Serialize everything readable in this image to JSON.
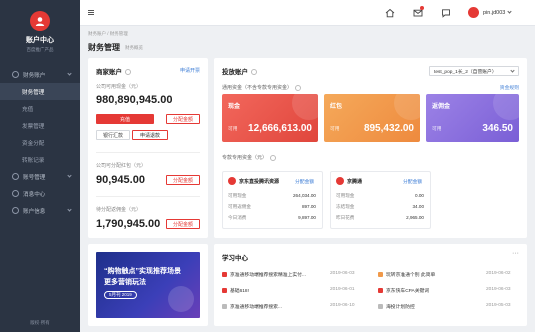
{
  "sidebar": {
    "title": "账户中心",
    "subtitle": "百度推广产品",
    "items": [
      {
        "label": "财务账户",
        "type": "group"
      },
      {
        "label": "财务管理",
        "type": "active"
      },
      {
        "label": "充值",
        "type": "sub"
      },
      {
        "label": "发票管理",
        "type": "sub"
      },
      {
        "label": "资金分配",
        "type": "sub"
      },
      {
        "label": "转账记录",
        "type": "sub"
      },
      {
        "label": "账号管理",
        "type": "group"
      },
      {
        "label": "消息中心",
        "type": "group"
      },
      {
        "label": "账户信息",
        "type": "group"
      }
    ],
    "footer": "版权·所有"
  },
  "topbar": {
    "username": "pin.jd003"
  },
  "breadcrumb": "财务账户  /  财务管理",
  "page": {
    "title": "财务管理",
    "subtitle": "财务概览"
  },
  "merchant": {
    "title": "商家账户",
    "open_link": "申请开票",
    "balance_label": "公司可用现金（元）",
    "balance": "980,890,945.00",
    "recharge_btn": "充值",
    "allocate_btn": "分配金额",
    "bank_transfer_btn": "银行汇款",
    "apply_refund_btn": "申请退款",
    "coupon_label": "公司可分配红包（元）",
    "coupon": "90,945.00",
    "coupon_allocate": "分配金额",
    "rebate_label": "待分配返佣金（元）",
    "rebate": "1,790,945.00",
    "rebate_allocate": "分配金额"
  },
  "banner": {
    "line1": "“购物触点”实现推荐场景",
    "line2": "更多营销玩法",
    "pill": "5月刊 2019"
  },
  "invest": {
    "title": "投放账户",
    "account_select": "test_pop_1长_2（自营账户）",
    "funds_label": "通用资金（不含专款专用资金）",
    "funds_rule": "资金规则",
    "tiles": [
      {
        "name": "现金",
        "use_label": "可用",
        "amount": "12,666,613.00",
        "color": "#ef5a4f"
      },
      {
        "name": "红包",
        "use_label": "可用",
        "amount": "895,432.00",
        "color": "#f0994a"
      },
      {
        "name": "返佣金",
        "use_label": "可用",
        "amount": "346.50",
        "color": "#8a6fdc"
      }
    ],
    "dedicated_label": "专款专用资金（元）",
    "media": [
      {
        "name": "京东直投腾讯资源",
        "link": "分配金额",
        "rows": [
          {
            "label": "可用现金",
            "value": "264,034.00"
          },
          {
            "label": "可用返佣金",
            "value": "897.00"
          },
          {
            "label": "今日消费",
            "value": "9,897.00"
          }
        ]
      },
      {
        "name": "京腾通",
        "link": "分配金额",
        "rows": [
          {
            "label": "可用现金",
            "value": "0.00"
          },
          {
            "label": "冻结现金",
            "value": "34.00"
          },
          {
            "label": "昨日花费",
            "value": "2,965.00"
          }
        ]
      }
    ]
  },
  "learning": {
    "title": "学习中心",
    "more": "···",
    "left": [
      {
        "title": "京准通移动端推荐搜索精准上实付...",
        "date": "2019-06-03",
        "tag_color": "#e53935"
      },
      {
        "title": "基础618!",
        "date": "2019-06-01",
        "tag_color": "#e53935"
      },
      {
        "title": "京准通移动端推荐搜索...",
        "date": "2019-06-10",
        "tag_color": "#bbbbbb"
      }
    ],
    "right": [
      {
        "title": "玩转京准通个别 此简单",
        "date": "2019-06-02",
        "tag_color": "#f0994a"
      },
      {
        "title": "京东快车CPA关键词",
        "date": "2019-06-03",
        "tag_color": "#e53935"
      },
      {
        "title": "海投计划防控",
        "date": "2019-05-03",
        "tag_color": "#bbbbbb"
      }
    ]
  }
}
